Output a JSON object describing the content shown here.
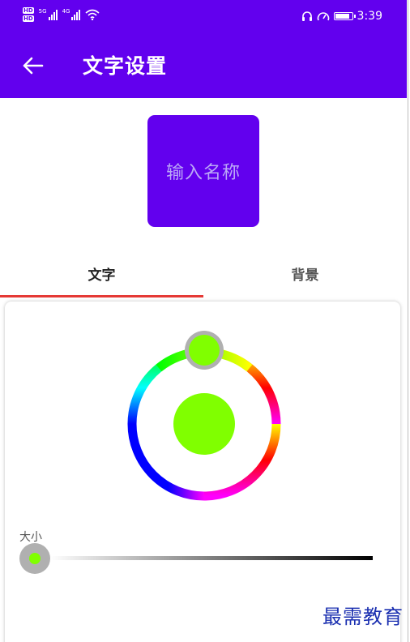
{
  "status_bar": {
    "hd_badge_top": "HD",
    "hd_badge_bottom": "HD",
    "signal1_label": "5G",
    "signal2_label": "4G",
    "time": "3:39",
    "icons": [
      "headset-icon",
      "speed-icon",
      "battery-icon",
      "wifi-icon"
    ]
  },
  "app_bar": {
    "back_icon": "arrow-left-icon",
    "title": "文字设置",
    "background_color": "#6200EE"
  },
  "preview": {
    "placeholder_text": "输入名称",
    "background_color": "#6200EE",
    "text_color": "#bba8f7"
  },
  "tabs": {
    "items": [
      {
        "label": "文字",
        "selected": true
      },
      {
        "label": "背景",
        "selected": false
      }
    ],
    "indicator_color": "#e53935"
  },
  "color_picker": {
    "selected_color": "#80FF00",
    "wheel_icon": "hue-ring"
  },
  "size_slider": {
    "label": "大小",
    "value_fraction": 0.0,
    "thumb_color": "#80FF00"
  },
  "watermark": {
    "text": "最需教育"
  }
}
